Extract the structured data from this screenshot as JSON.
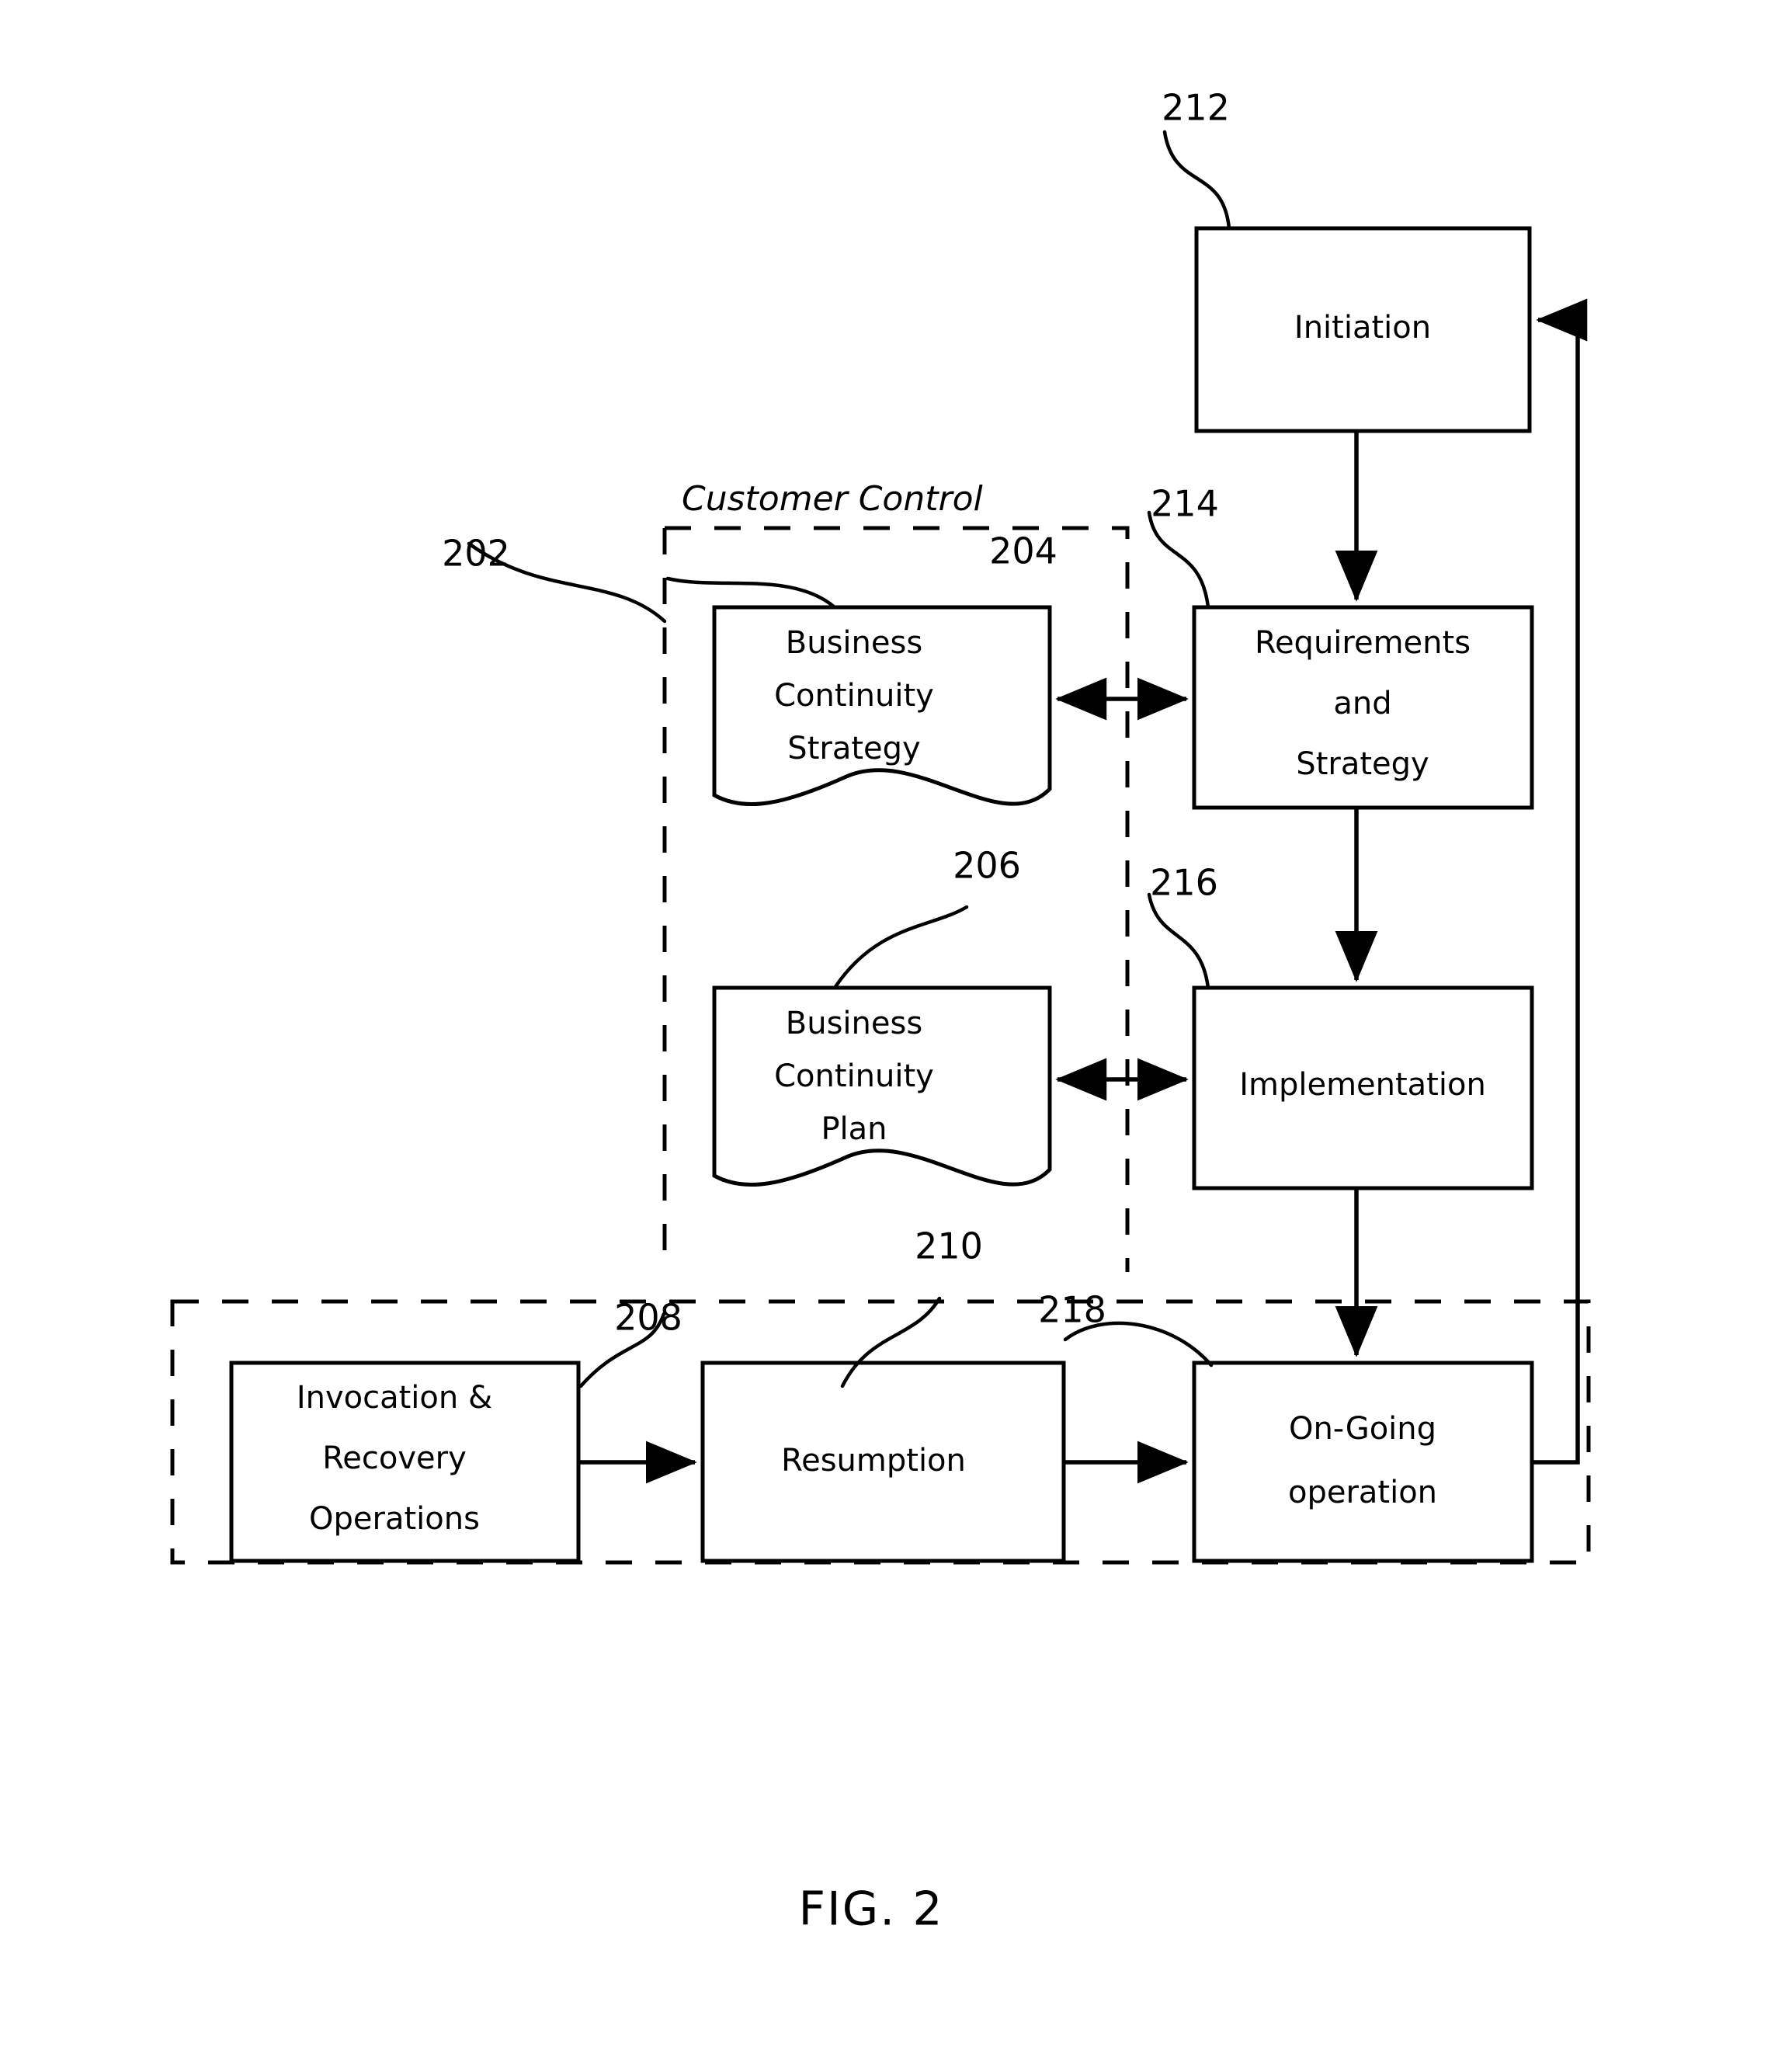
{
  "figure": {
    "caption": "FIG. 2",
    "background_color": "#ffffff",
    "line_color": "#000000"
  },
  "regions": [
    {
      "id": "customer-control",
      "ref": "202",
      "title": "Customer Control",
      "style": "dashed"
    },
    {
      "id": "service-provider-lower",
      "ref": "",
      "title": "",
      "style": "dashed"
    }
  ],
  "nodes": [
    {
      "id": "initiation",
      "ref": "212",
      "label": "Initiation",
      "shape": "rectangle",
      "lines": [
        "Initiation"
      ]
    },
    {
      "id": "requirements-and-strategy",
      "ref": "214",
      "label": "Requirements and Strategy",
      "shape": "rectangle",
      "lines": [
        "Requirements",
        "and",
        "Strategy"
      ]
    },
    {
      "id": "implementation",
      "ref": "216",
      "label": "Implementation",
      "shape": "rectangle",
      "lines": [
        "Implementation"
      ]
    },
    {
      "id": "on-going-operation",
      "ref": "218",
      "label": "On-Going operation",
      "shape": "rectangle",
      "lines": [
        "On-Going",
        "operation"
      ]
    },
    {
      "id": "business-continuity-strategy",
      "ref": "204",
      "label": "Business Continuity Strategy",
      "shape": "document",
      "lines": [
        "Business",
        "Continuity",
        "Strategy"
      ]
    },
    {
      "id": "business-continuity-plan",
      "ref": "206",
      "label": "Business Continuity Plan",
      "shape": "document",
      "lines": [
        "Business",
        "Continuity",
        "Plan"
      ]
    },
    {
      "id": "invocation-and-recovery-operations",
      "ref": "208",
      "label": "Invocation & Recovery Operations",
      "shape": "rectangle",
      "lines": [
        "Invocation &",
        "Recovery",
        "Operations"
      ]
    },
    {
      "id": "resumption",
      "ref": "210",
      "label": "Resumption",
      "shape": "rectangle",
      "lines": [
        "Resumption"
      ]
    }
  ],
  "ref_numbers": [
    {
      "id": "ref-202",
      "text": "202"
    },
    {
      "id": "ref-204",
      "text": "204"
    },
    {
      "id": "ref-206",
      "text": "206"
    },
    {
      "id": "ref-208",
      "text": "208"
    },
    {
      "id": "ref-210",
      "text": "210"
    },
    {
      "id": "ref-212",
      "text": "212"
    },
    {
      "id": "ref-214",
      "text": "214"
    },
    {
      "id": "ref-216",
      "text": "216"
    },
    {
      "id": "ref-218",
      "text": "218"
    }
  ],
  "connections": [
    {
      "id": "initiation-to-requirements",
      "from": "initiation",
      "to": "requirements-and-strategy",
      "kind": "arrow-down"
    },
    {
      "id": "requirements-to-implementation",
      "from": "requirements-and-strategy",
      "to": "implementation",
      "kind": "arrow-down"
    },
    {
      "id": "implementation-to-ongoing",
      "from": "implementation",
      "to": "on-going-operation",
      "kind": "arrow-down"
    },
    {
      "id": "ongoing-to-initiation-feedback",
      "from": "on-going-operation",
      "to": "initiation",
      "kind": "feedback-arrow"
    },
    {
      "id": "bcs-requirements-exchange",
      "from": "business-continuity-strategy",
      "to": "requirements-and-strategy",
      "kind": "double-arrow"
    },
    {
      "id": "bcp-implementation-exchange",
      "from": "business-continuity-plan",
      "to": "implementation",
      "kind": "double-arrow"
    },
    {
      "id": "invocation-to-resumption",
      "from": "invocation-and-recovery-operations",
      "to": "resumption",
      "kind": "arrow-right"
    },
    {
      "id": "resumption-to-ongoing",
      "from": "resumption",
      "to": "on-going-operation",
      "kind": "arrow-right"
    }
  ]
}
